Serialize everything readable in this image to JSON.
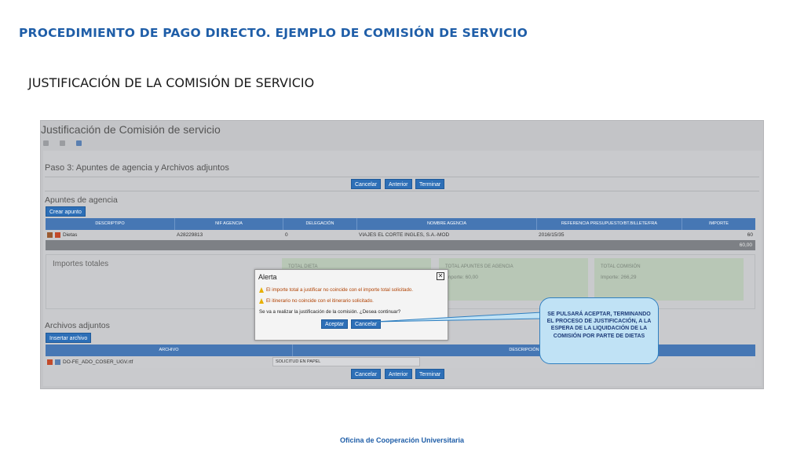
{
  "slide": {
    "title": "PROCEDIMIENTO DE PAGO DIRECTO. EJEMPLO DE COMISIÓN DE SERVICIO",
    "subtitle": "JUSTIFICACIÓN DE LA COMISIÓN DE SERVICIO",
    "footer": "Oficina de Cooperación Universitaria"
  },
  "app": {
    "window_title": "Justificación de Comisión de servicio",
    "step_title": "Paso 3: Apuntes de agencia y Archivos adjuntos",
    "buttons": {
      "cancel": "Cancelar",
      "previous": "Anterior",
      "finish": "Terminar"
    },
    "agency": {
      "section_title": "Apuntes de agencia",
      "create_button": "Crear apunto",
      "columns": [
        "DESCRIPTIPO",
        "NIF AGENCIA",
        "DELEGACIÓN",
        "NOMBRE AGENCIA",
        "REFERENCIA PRESUPUESTO/BT.BILLETE/FRA",
        "IMPORTE"
      ],
      "rows": [
        {
          "descriptipo": "Dietas",
          "nif": "A28229813",
          "delegacion": "0",
          "nombre": "VIAJES EL CORTE INGLES, S.A.-MOD",
          "referencia": "2016/15/35",
          "importe": "60"
        }
      ],
      "total": "60,00"
    },
    "totals": {
      "title": "Importes totales",
      "cards": [
        {
          "label": "TOTAL DIETA",
          "value": ""
        },
        {
          "label": "TOTAL APUNTES DE AGENCIA",
          "value": "Importe: 60,00"
        },
        {
          "label": "TOTAL COMISIÓN",
          "value": "Importe: 266,29"
        }
      ]
    },
    "attachments": {
      "section_title": "Archivos adjuntos",
      "insert_button": "Insertar archivo",
      "columns": [
        "ARCHIVO",
        "DESCRIPCIÓN"
      ],
      "rows": [
        {
          "archivo": "DO-FE_ADO_COSER_UGV.rtf",
          "descripcion": "SOLICITUD EN PAPEL"
        }
      ]
    },
    "dialog": {
      "title": "Alerta",
      "close": "✕",
      "warning_1": "El importe total a justificar no coincide con el importe total solicitado.",
      "warning_2": "El itinerario no coincide con el itinerario solicitado.",
      "question": "Se va a realizar la justificación de la comisión. ¿Desea continuar?",
      "accept": "Aceptar",
      "cancel": "Cancelar"
    }
  },
  "callout": {
    "text": "SE PULSARÁ ACEPTAR, TERMINANDO EL PROCESO DE JUSTIFICACIÓN, A LA ESPERA DE LA LIQUIDACIÓN DE LA COMISIÓN POR PARTE DE DIETAS"
  },
  "colors": {
    "accent": "#2d6fb7",
    "header_blue": "#4677b4",
    "title_blue": "#1f5ea8",
    "callout_fill": "#c0e2f5",
    "warning": "#b04000"
  }
}
